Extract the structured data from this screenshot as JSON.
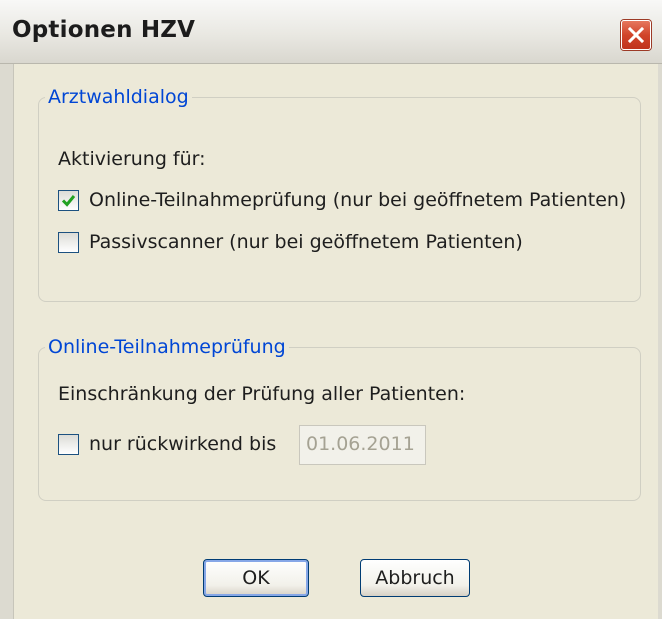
{
  "window": {
    "title": "Optionen HZV"
  },
  "groups": {
    "arztwahl": {
      "legend": "Arztwahldialog",
      "activation_label": "Aktivierung für:",
      "options": [
        {
          "label": "Online-Teilnahmeprüfung (nur bei geöffnetem Patienten)",
          "checked": true
        },
        {
          "label": "Passivscanner (nur bei geöffnetem Patienten)",
          "checked": false
        }
      ]
    },
    "online": {
      "legend": "Online-Teilnahmeprüfung",
      "restriction_label": "Einschränkung der Prüfung aller Patienten:",
      "retro_label": "nur rückwirkend bis",
      "retro_checked": false,
      "date_value": "01.06.2011",
      "date_enabled": false
    }
  },
  "buttons": {
    "ok": "OK",
    "cancel": "Abbruch"
  },
  "colors": {
    "legend_text": "#0046d5",
    "close_button": "#d1442a",
    "check_mark": "#21a121"
  },
  "icons": {
    "close": "close-icon",
    "check": "checkmark-icon"
  }
}
